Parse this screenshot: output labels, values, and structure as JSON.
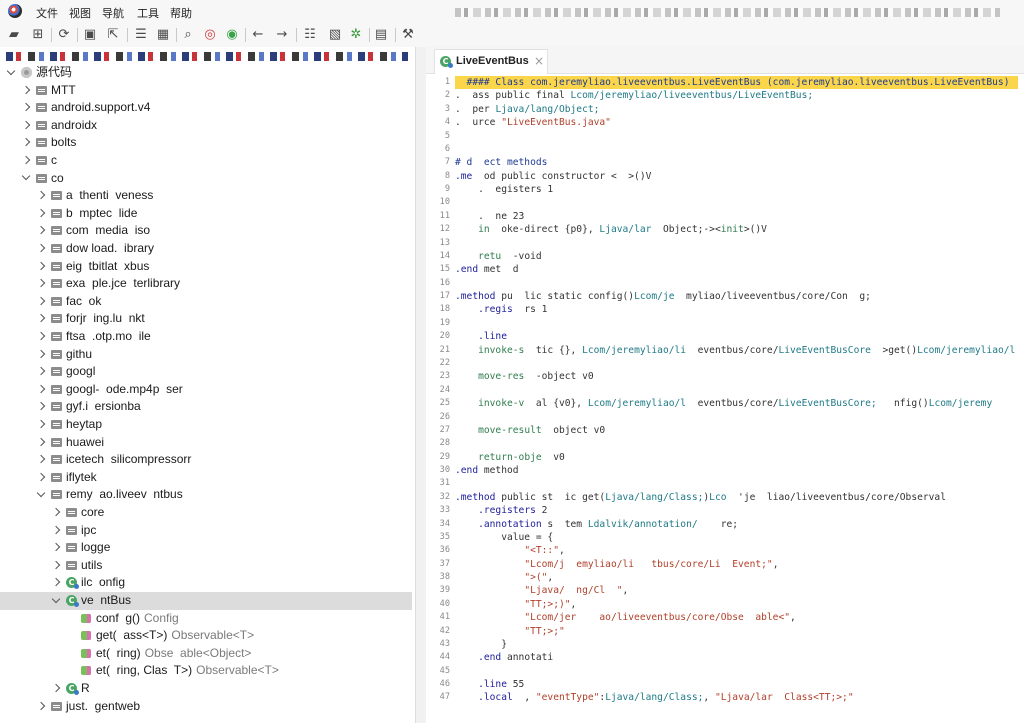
{
  "menu": [
    "文件",
    "视图",
    "导航",
    "工具",
    "帮助"
  ],
  "toolbar": [
    {
      "icon": "open-file-icon",
      "glyph": "▰"
    },
    {
      "icon": "add-files-icon",
      "glyph": "⊞"
    },
    {
      "icon": "reload-icon",
      "glyph": "⟳"
    },
    {
      "icon": "save-icon",
      "glyph": "▣"
    },
    {
      "icon": "export-icon",
      "glyph": "⇱"
    },
    {
      "icon": "flatten-packages-icon",
      "glyph": "☰"
    },
    {
      "icon": "package-view-icon",
      "glyph": "▦"
    },
    {
      "icon": "search-icon",
      "glyph": "⌕"
    },
    {
      "icon": "find-usage-icon",
      "glyph": "◎",
      "color": "#d33a3a"
    },
    {
      "icon": "find-text-icon",
      "glyph": "◉",
      "color": "#3aa34a"
    },
    {
      "icon": "back-icon",
      "glyph": "←"
    },
    {
      "icon": "forward-icon",
      "glyph": "→"
    },
    {
      "icon": "deobfuscation-icon",
      "glyph": "☷"
    },
    {
      "icon": "quark-icon",
      "glyph": "▧"
    },
    {
      "icon": "debug-icon",
      "glyph": "✲",
      "color": "#3a9a3a"
    },
    {
      "icon": "log-viewer-icon",
      "glyph": "▤"
    },
    {
      "icon": "settings-wrench-icon",
      "glyph": "⚒"
    }
  ],
  "tree": {
    "items": [
      {
        "label": "源代码",
        "level": 0,
        "icon": "source-folder-icon",
        "expanded": true
      },
      {
        "label": "MTT",
        "level": 1,
        "icon": "package-icon",
        "expanded": false
      },
      {
        "label": "android.support.v4",
        "level": 1,
        "icon": "package-icon",
        "expanded": false
      },
      {
        "label": "androidx",
        "level": 1,
        "icon": "package-icon",
        "expanded": false
      },
      {
        "label": "bolts",
        "level": 1,
        "icon": "package-icon",
        "expanded": false
      },
      {
        "label": "c",
        "level": 1,
        "icon": "package-icon",
        "expanded": false
      },
      {
        "label": "co",
        "level": 1,
        "icon": "package-icon",
        "expanded": true
      },
      {
        "label": "a  thenti  veness",
        "level": 2,
        "icon": "package-icon",
        "expanded": false
      },
      {
        "label": "b  mptec  lide",
        "level": 2,
        "icon": "package-icon",
        "expanded": false
      },
      {
        "label": "com  media  iso",
        "level": 2,
        "icon": "package-icon",
        "expanded": false
      },
      {
        "label": "dow load.  ibrary",
        "level": 2,
        "icon": "package-icon",
        "expanded": false
      },
      {
        "label": "eig  tbitlat  xbus",
        "level": 2,
        "icon": "package-icon",
        "expanded": false
      },
      {
        "label": "exa  ple.jce  terlibrary",
        "level": 2,
        "icon": "package-icon",
        "expanded": false
      },
      {
        "label": "fac  ok",
        "level": 2,
        "icon": "package-icon",
        "expanded": false
      },
      {
        "label": "forjr  ing.lu  nkt",
        "level": 2,
        "icon": "package-icon",
        "expanded": false
      },
      {
        "label": "ftsa  .otp.mo  ile",
        "level": 2,
        "icon": "package-icon",
        "expanded": false
      },
      {
        "label": "githu",
        "level": 2,
        "icon": "package-icon",
        "expanded": false
      },
      {
        "label": "googl",
        "level": 2,
        "icon": "package-icon",
        "expanded": false
      },
      {
        "label": "googl-  ode.mp4p  ser",
        "level": 2,
        "icon": "package-icon",
        "expanded": false
      },
      {
        "label": "gyf.i  ersionba",
        "level": 2,
        "icon": "package-icon",
        "expanded": false
      },
      {
        "label": "heytap",
        "level": 2,
        "icon": "package-icon",
        "expanded": false
      },
      {
        "label": "huawei",
        "level": 2,
        "icon": "package-icon",
        "expanded": false
      },
      {
        "label": "icetech  silicompressorr",
        "level": 2,
        "icon": "package-icon",
        "expanded": false
      },
      {
        "label": "iflytek",
        "level": 2,
        "icon": "package-icon",
        "expanded": false
      },
      {
        "label": "remy  ao.liveev  ntbus",
        "level": 2,
        "icon": "package-icon",
        "expanded": true
      },
      {
        "label": "core",
        "level": 3,
        "icon": "package-icon",
        "expanded": false
      },
      {
        "label": "ipc",
        "level": 3,
        "icon": "package-icon",
        "expanded": false
      },
      {
        "label": "logge",
        "level": 3,
        "icon": "package-icon",
        "expanded": false
      },
      {
        "label": "utils",
        "level": 3,
        "icon": "package-icon",
        "expanded": false
      },
      {
        "label": "ilc  onfig",
        "level": 3,
        "icon": "class-icon",
        "expanded": false
      },
      {
        "label": "ve  ntBus",
        "level": 3,
        "icon": "class-icon",
        "expanded": true,
        "selected": true
      },
      {
        "label": "conf  g()",
        "suffix": "Config",
        "level": 4,
        "icon": "method-icon"
      },
      {
        "label": "get(  ass<T>)",
        "suffix": "Observable<T>",
        "level": 4,
        "icon": "method-icon"
      },
      {
        "label": "et(  ring)",
        "suffix": "Obse  able<Object>",
        "level": 4,
        "icon": "method-icon"
      },
      {
        "label": "et(  ring, Clas  T>)",
        "suffix": "Observable<T>",
        "level": 4,
        "icon": "method-icon"
      },
      {
        "label": "R",
        "level": 3,
        "icon": "class-icon",
        "expanded": false
      },
      {
        "label": "just.  gentweb",
        "level": 2,
        "icon": "package-icon",
        "expanded": false
      }
    ]
  },
  "editor": {
    "tab": {
      "label": "LiveEventBus",
      "close": "×"
    },
    "lines": [
      {
        "n": "1",
        "code": "  #### Class com.jeremyliao.liveeventbus.LiveEventBus (com.jeremyliao.liveeventbus.LiveEventBus)"
      },
      {
        "n": "2",
        "code": ".  ass public final Lcom/jeremyliao/liveeventbus/LiveEventBus;"
      },
      {
        "n": "3",
        "code": ".  per Ljava/lang/Object;"
      },
      {
        "n": "4",
        "code": ".  urce \"LiveEventBus.java\""
      },
      {
        "n": "5",
        "code": ""
      },
      {
        "n": "6",
        "code": ""
      },
      {
        "n": "7",
        "code": "# d  ect methods"
      },
      {
        "n": "8",
        "code": ".me  od public constructor <  >()V"
      },
      {
        "n": "9",
        "code": "    .  egisters 1"
      },
      {
        "n": "10",
        "code": ""
      },
      {
        "n": "11",
        "code": "    .  ne 23"
      },
      {
        "n": "12",
        "code": "    in  oke-direct {p0}, Ljava/lar  Object;-><init>()V"
      },
      {
        "n": "13",
        "code": ""
      },
      {
        "n": "14",
        "code": "    retu  -void"
      },
      {
        "n": "15",
        "code": ".end met  d"
      },
      {
        "n": "16",
        "code": ""
      },
      {
        "n": "17",
        "code": ".method pu  lic static config()Lcom/je  myliao/liveeventbus/core/Con  g;"
      },
      {
        "n": "18",
        "code": "    .regis  rs 1"
      },
      {
        "n": "19",
        "code": ""
      },
      {
        "n": "20",
        "code": "    .line"
      },
      {
        "n": "21",
        "code": "    invoke-s  tic {}, Lcom/jeremyliao/li  eventbus/core/LiveEventBusCore  >get()Lcom/jeremyliao/l"
      },
      {
        "n": "22",
        "code": ""
      },
      {
        "n": "23",
        "code": "    move-res  -object v0"
      },
      {
        "n": "24",
        "code": ""
      },
      {
        "n": "25",
        "code": "    invoke-v  al {v0}, Lcom/jeremyliao/l  eventbus/core/LiveEventBusCore;   nfig()Lcom/jeremy"
      },
      {
        "n": "26",
        "code": ""
      },
      {
        "n": "27",
        "code": "    move-result  object v0"
      },
      {
        "n": "28",
        "code": ""
      },
      {
        "n": "29",
        "code": "    return-obje  v0"
      },
      {
        "n": "30",
        "code": ".end method"
      },
      {
        "n": "31",
        "code": ""
      },
      {
        "n": "32",
        "code": ".method public st  ic get(Ljava/lang/Class;)Lco  'je  liao/liveeventbus/core/Observal"
      },
      {
        "n": "33",
        "code": "    .registers 2"
      },
      {
        "n": "34",
        "code": "    .annotation s  tem Ldalvik/annotation/    re;"
      },
      {
        "n": "35",
        "code": "        value = {"
      },
      {
        "n": "36",
        "code": "            \"<T::\","
      },
      {
        "n": "37",
        "code": "            \"Lcom/j  emyliao/li   tbus/core/Li  Event;\","
      },
      {
        "n": "38",
        "code": "            \">(\","
      },
      {
        "n": "39",
        "code": "            \"Ljava/  ng/Cl  \","
      },
      {
        "n": "40",
        "code": "            \"TT;>;)\","
      },
      {
        "n": "41",
        "code": "            \"Lcom/jer    ao/liveeventbus/core/Obse  able<\","
      },
      {
        "n": "42",
        "code": "            \"TT;>;\""
      },
      {
        "n": "43",
        "code": "        }"
      },
      {
        "n": "44",
        "code": "    .end annotati"
      },
      {
        "n": "45",
        "code": ""
      },
      {
        "n": "46",
        "code": "    .line 55"
      },
      {
        "n": "47",
        "code": "    .local  , \"eventType\":Ljava/lang/Class;, \"Ljava/lar  Class<TT;>;\""
      }
    ]
  },
  "colors": {
    "line_highlight": "#fbd64a",
    "selection": "#dcdcdc",
    "class_icon": "#4aa564"
  }
}
